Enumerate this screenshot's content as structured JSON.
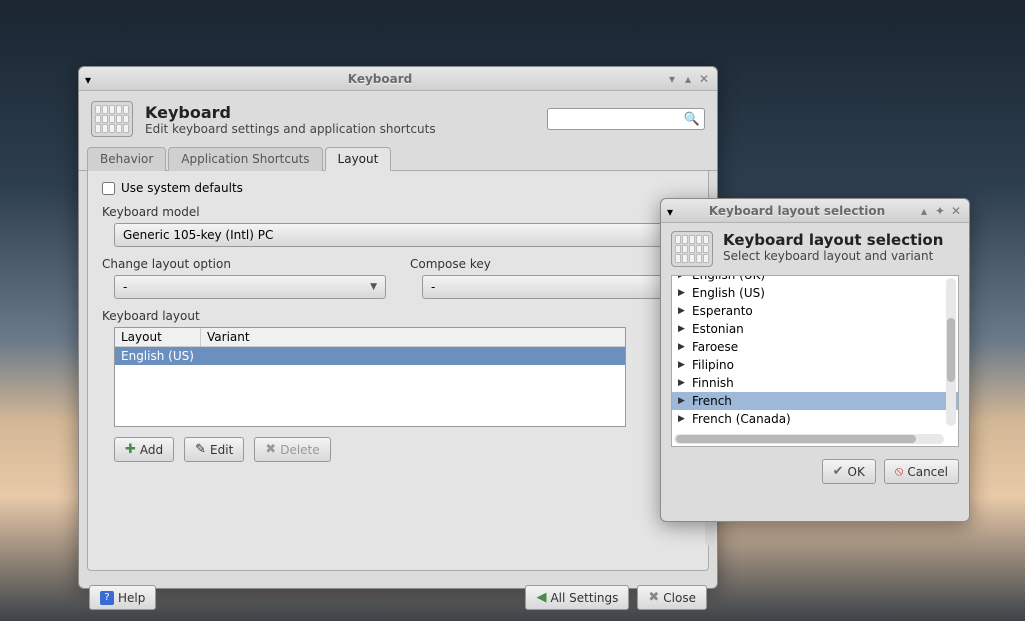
{
  "main_window": {
    "title": "Keyboard",
    "header_title": "Keyboard",
    "header_subtitle": "Edit keyboard settings and application shortcuts",
    "tabs": [
      "Behavior",
      "Application Shortcuts",
      "Layout"
    ],
    "active_tab": 2,
    "use_system_defaults_label": "Use system defaults",
    "use_system_defaults_checked": false,
    "keyboard_model_label": "Keyboard model",
    "keyboard_model_value": "Generic 105-key (Intl) PC",
    "change_layout_label": "Change layout option",
    "change_layout_value": "-",
    "compose_key_label": "Compose key",
    "compose_key_value": "-",
    "keyboard_layout_label": "Keyboard layout",
    "layout_table": {
      "columns": [
        "Layout",
        "Variant"
      ],
      "rows": [
        {
          "layout": "English (US)",
          "variant": "",
          "selected": true
        }
      ]
    },
    "buttons": {
      "add": "Add",
      "edit": "Edit",
      "delete": "Delete"
    },
    "footer": {
      "help": "Help",
      "all_settings": "All Settings",
      "close": "Close"
    }
  },
  "sub_window": {
    "title": "Keyboard layout selection",
    "header_title": "Keyboard layout selection",
    "header_subtitle": "Select keyboard layout and variant",
    "items": [
      {
        "label": "English (UK)",
        "partial": true
      },
      {
        "label": "English (US)"
      },
      {
        "label": "Esperanto"
      },
      {
        "label": "Estonian"
      },
      {
        "label": "Faroese"
      },
      {
        "label": "Filipino"
      },
      {
        "label": "Finnish"
      },
      {
        "label": "French",
        "selected": true
      },
      {
        "label": "French (Canada)",
        "partial_bottom": true
      }
    ],
    "buttons": {
      "ok": "OK",
      "cancel": "Cancel"
    }
  }
}
